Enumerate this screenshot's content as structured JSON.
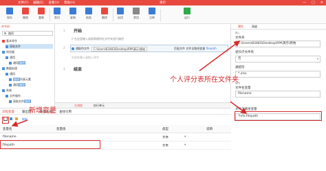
{
  "app": {
    "menu": [
      "文件(F)",
      "编辑(E)",
      "查看(V)",
      "帮助(H)"
    ],
    "window_title": "演示",
    "window_controls": [
      "—",
      "□",
      "✕"
    ]
  },
  "toolbar": {
    "buttons": [
      {
        "label": "保存",
        "icon": "save-icon",
        "color": "#3a7bd5"
      },
      {
        "label": "撤销",
        "icon": "undo-icon",
        "color": "#e8493f"
      },
      {
        "label": "重做",
        "icon": "redo-icon",
        "color": "#e8493f"
      },
      {
        "label": "剪切",
        "icon": "cut-icon",
        "color": "#3a7bd5"
      },
      {
        "label": "复制",
        "icon": "copy-icon",
        "color": "#3a7bd5"
      },
      {
        "label": "粘贴",
        "icon": "paste-icon",
        "color": "#3a7bd5"
      },
      {
        "label": "删除",
        "icon": "delete-icon",
        "color": "#e8493f"
      },
      {
        "label": "启用",
        "icon": "enable-icon",
        "color": "#3a7bd5"
      },
      {
        "label": "禁用",
        "icon": "disable-icon",
        "color": "#888888"
      },
      {
        "label": "注释",
        "icon": "comment-icon",
        "color": "#3a7bd5"
      },
      {
        "label": "运行",
        "icon": "run-icon",
        "color": "#2eaa4a"
      }
    ]
  },
  "left_panel": {
    "tab": "命令树",
    "search_value": "路径",
    "tree": [
      {
        "label": "基本命令",
        "accent": "#e8493f"
      },
      {
        "label": "获取文件",
        "accent": "#4a90d9",
        "highlight": "路径",
        "selected": true
      },
      {
        "label": "浏览器",
        "accent": "#4a90d9"
      },
      {
        "label": "通用",
        "accent": "#4a90d9"
      },
      {
        "label": "通用路径",
        "accent": "#4a90d9",
        "highlight": "路径"
      },
      {
        "label": "数据处理",
        "accent": "#4a90d9"
      },
      {
        "label": "通用",
        "accent": "#4a90d9"
      },
      {
        "label": "路径列表元素",
        "accent": "#4a90d9",
        "highlight": "路径"
      },
      {
        "label": "通用路径",
        "accent": "#4a90d9",
        "highlight": "路径"
      },
      {
        "label": "系统",
        "accent": "#4a90d9"
      },
      {
        "label": "文件操作",
        "accent": "#4a90d9"
      },
      {
        "label": "获取文件路径",
        "accent": "#4a90d9",
        "highlight": "路径"
      }
    ]
  },
  "editor": {
    "start_label": "开始",
    "end_label": "结束",
    "line_numbers": [
      "1",
      "2",
      "3"
    ],
    "comment": "// 在这里输入成绩表格所在文件夹进行路径",
    "step": {
      "prefix": "通配符文件",
      "path": "C:\\Users\\83483\\Desktop\\RPA演示\\原始",
      "middle": "匹配文件",
      "suffix": "文件全路径变量",
      "var": "filepath"
    },
    "add_hint": "在此处输入或拖入命令",
    "bottom_tabs": [
      "主流程",
      "执行单元"
    ]
  },
  "right_panel": {
    "tabs": [
      "属性",
      "高级"
    ],
    "labels": {
      "input_section": "输入",
      "folder": "文件夹",
      "include_sub": "递归子文件夹",
      "wildcard": "通配符",
      "output_section": "输出",
      "count_var": "文件名变量",
      "fullpath_var": "文件全路径变量"
    },
    "values": {
      "folder": "C:\\Users\\83483\\Desktop\\RPA演示\\原始",
      "include_sub": "否",
      "wildcard": "*.xlsx",
      "count_var": "filename",
      "fullpath_var": "*info.filepath"
    }
  },
  "annotations": {
    "folder_note": "个人评分表所在文件夹",
    "new_var_note": "新增变量",
    "color": "#d42b2b"
  },
  "bottom_panel": {
    "tabs": [
      "流程变量",
      "输出区",
      "数据表格",
      "查找引用"
    ],
    "tools": {
      "refresh": "刷新"
    },
    "columns": [
      "变量名",
      "变量值",
      "类型",
      "说明"
    ],
    "rows": [
      {
        "name": "filename",
        "value": "",
        "type": "文本"
      },
      {
        "name": "filepath",
        "value": "",
        "type": "文本"
      }
    ]
  }
}
